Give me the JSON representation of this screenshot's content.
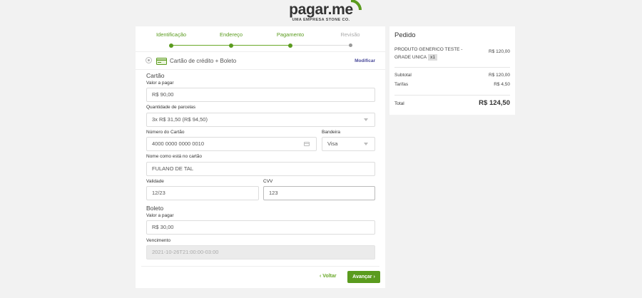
{
  "brand": {
    "name": "pagar.me",
    "tagline": "UMA EMPRESA STONE CO.",
    "accent": "#5a9b1e"
  },
  "steps": [
    {
      "label": "Identificação",
      "state": "done"
    },
    {
      "label": "Endereço",
      "state": "done"
    },
    {
      "label": "Pagamento",
      "state": "current"
    },
    {
      "label": "Revisão",
      "state": "todo"
    }
  ],
  "payment_method": {
    "label": "Cartão de crédito + Boleto",
    "modify_label": "Modificar",
    "icon": "credit-card-icon"
  },
  "card": {
    "section_title": "Cartão",
    "amount_label": "Valor a pagar",
    "amount_value": "R$ 90,00",
    "installments_label": "Quantidade de parcelas",
    "installments_value": "3x R$ 31,50 (R$ 94,50)",
    "number_label": "Número do Cartão",
    "number_value": "4000 0000 0000 0010",
    "brand_label": "Bandeira",
    "brand_value": "Visa",
    "holder_label": "Nome como está no cartão",
    "holder_value": "FULANO DE TAL",
    "expiry_label": "Validade",
    "expiry_value": "12/23",
    "cvv_label": "CVV",
    "cvv_value": "123"
  },
  "boleto": {
    "section_title": "Boleto",
    "amount_label": "Valor a pagar",
    "amount_value": "R$ 30,00",
    "due_label": "Vencimento",
    "due_value": "2021-10-26T21:00:00-03:00"
  },
  "actions": {
    "back_label": "Voltar",
    "advance_label": "Avançar",
    "back_icon": "chevron-left-icon",
    "advance_icon": "chevron-right-icon"
  },
  "order": {
    "title": "Pedido",
    "product_name": "PRODUTO GENERICO TESTE - GRADE UNICA",
    "product_qty": "x1",
    "product_price": "R$ 120,00",
    "subtotal_label": "Subtotal",
    "subtotal_value": "R$ 120,00",
    "fees_label": "Tarifas",
    "fees_value": "R$ 4,50",
    "total_label": "Total",
    "total_value": "R$ 124,50"
  }
}
